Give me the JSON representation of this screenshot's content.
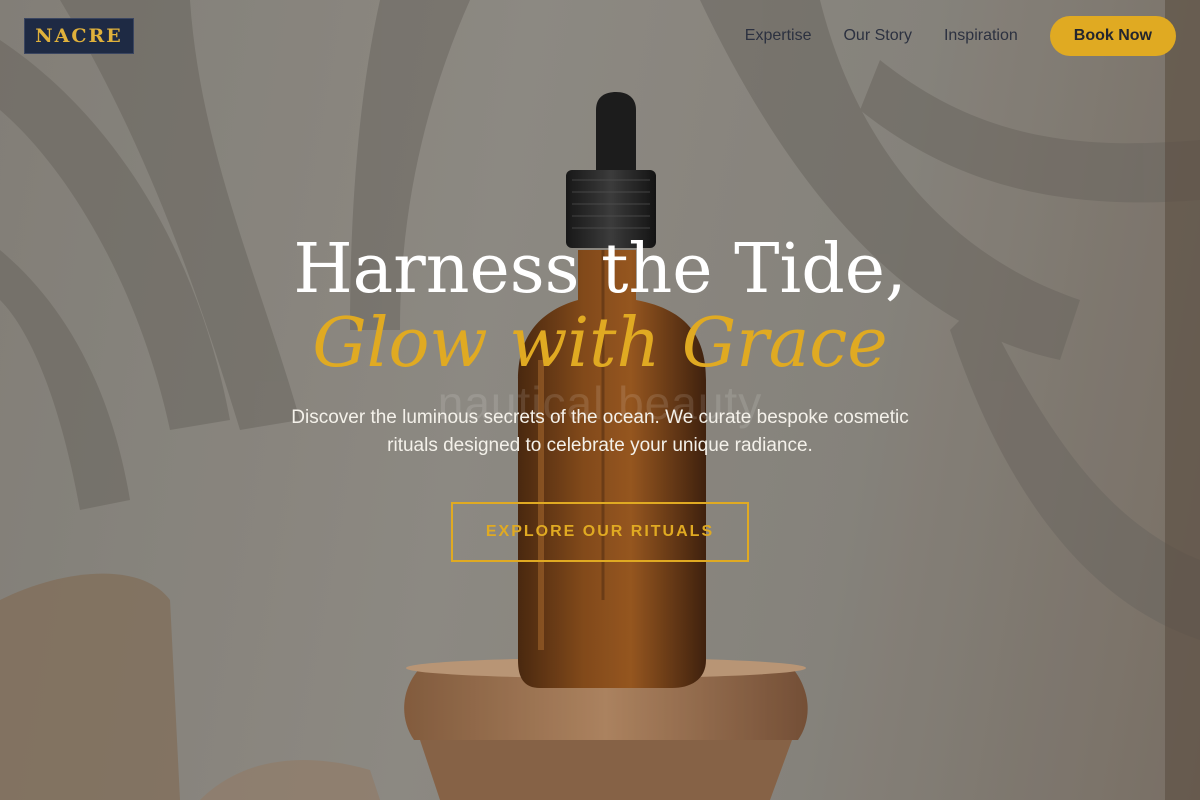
{
  "brand": {
    "logo": "NACRE"
  },
  "nav": {
    "items": [
      {
        "label": "Expertise"
      },
      {
        "label": "Our Story"
      },
      {
        "label": "Inspiration"
      }
    ],
    "book_label": "Book Now"
  },
  "hero": {
    "title_line1": "Harness the Tide,",
    "title_line2": "Glow with Grace",
    "ghost_text": "nautical beauty",
    "subtitle": "Discover the luminous secrets of the ocean. We curate bespoke cosmetic rituals designed to celebrate your unique radiance.",
    "cta_label": "EXPLORE OUR RITUALS"
  },
  "colors": {
    "accent": "#e0aa22",
    "logo_bg": "#1e2a44",
    "nav_text": "#2c3140"
  },
  "image": {
    "subject": "amber dropper bottle on wooden pedestal with palm leaf shadows"
  }
}
